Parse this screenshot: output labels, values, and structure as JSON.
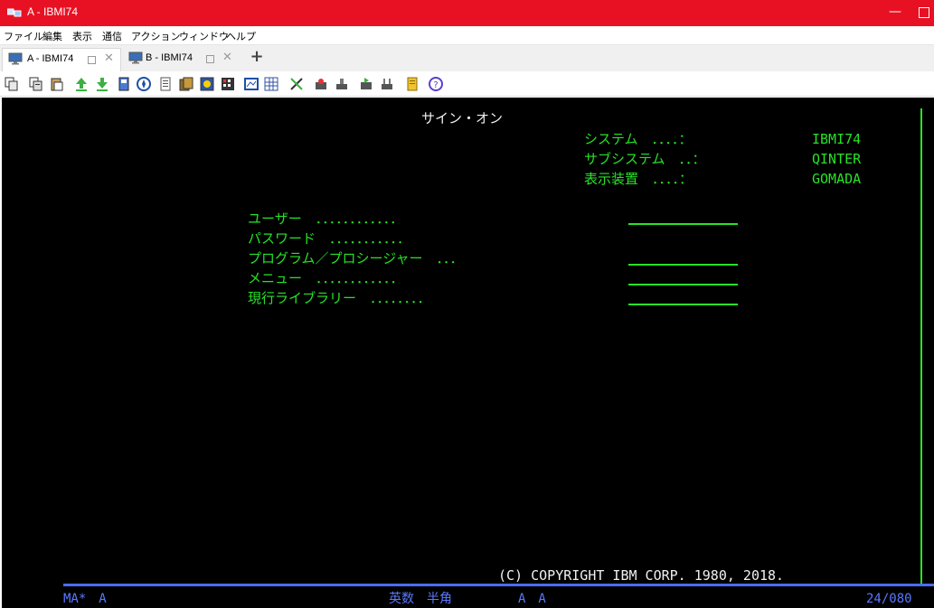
{
  "window": {
    "title": "A - IBMI74",
    "minimize_glyph": "—",
    "icons": {
      "app": "terminal-app-icon",
      "minimize": "minimize-icon",
      "maximize": "maximize-icon"
    }
  },
  "menu": {
    "items": [
      "ファイル",
      "編集",
      "表示",
      "通信",
      "アクション",
      "ウィンドウ",
      "ヘルプ"
    ]
  },
  "tabs": [
    {
      "label": "A - IBMI74",
      "active": true
    },
    {
      "label": "B - IBMI74",
      "active": false
    }
  ],
  "add_tab_glyph": "+",
  "close_glyph": "✕",
  "toolbar": {
    "icons": [
      "copy-icon",
      "copy-append-icon",
      "paste-icon",
      "upload-icon",
      "download-icon",
      "save-icon",
      "compass-icon",
      "print-icon",
      "macro-icon",
      "settings-icon",
      "keyboard-icon",
      "screen-icon",
      "grid-icon",
      "edit-icon",
      "record-icon",
      "stop-icon",
      "play-icon",
      "pause-icon",
      "notes-icon",
      "help-icon"
    ]
  },
  "terminal": {
    "screen_title": "サイン・オン",
    "system_info": [
      {
        "label": "システム　．．．．：",
        "value": "IBMI74"
      },
      {
        "label": "サブシステム　．．：",
        "value": "QINTER"
      },
      {
        "label": "表示装置　．．．．：",
        "value": "GOMADA"
      }
    ],
    "fields": [
      {
        "label": "ユーザー　．．．．．．．．．．．．",
        "has_underline": true
      },
      {
        "label": "パスワード　．．．．．．．．．．．",
        "has_underline": false
      },
      {
        "label": "プログラム／プロシージャー　．．．",
        "has_underline": true
      },
      {
        "label": "メニュー　．．．．．．．．．．．．",
        "has_underline": true
      },
      {
        "label": "現行ライブラリー　．．．．．．．．",
        "has_underline": true
      }
    ],
    "copyright": "(C) COPYRIGHT IBM CORP. 1980, 2018.",
    "status": {
      "left": "MA*　A",
      "input_mode": "英数　半角",
      "mode_flags": "A　A",
      "position": "24/080"
    }
  },
  "colors": {
    "title_bar": "#e81123",
    "terminal_bg": "#000000",
    "terminal_green": "#27e327",
    "terminal_white": "#f0f0f0",
    "status_blue": "#5a78ff"
  }
}
